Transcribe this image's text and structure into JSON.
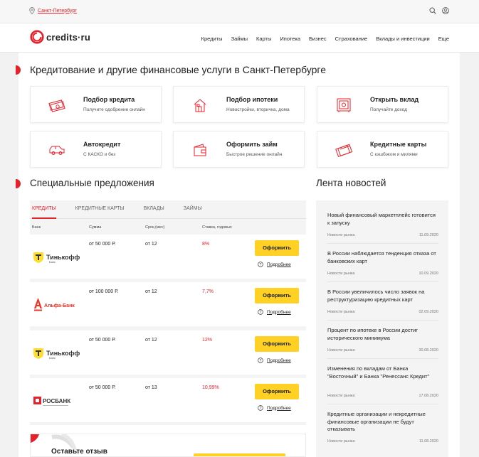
{
  "topbar": {
    "city": "Санкт-Петербург"
  },
  "logo": {
    "text": "credits·ru"
  },
  "nav": [
    "Кредиты",
    "Займы",
    "Карты",
    "Ипотека",
    "Бизнес",
    "Страхование",
    "Вклады и инвестиции",
    "Еще"
  ],
  "page_title": "Кредитование и другие финансовые услуги в Санкт-Петербурге",
  "services": [
    {
      "title": "Подбор кредита",
      "subtitle": "Получите одобрение онлайн",
      "icon": "money-icon"
    },
    {
      "title": "Подбор ипотеки",
      "subtitle": "Новостройки, вторичка, дома",
      "icon": "house-icon"
    },
    {
      "title": "Открыть вклад",
      "subtitle": "Получайте доход",
      "icon": "safe-icon"
    },
    {
      "title": "Автокредит",
      "subtitle": "С КАСКО и без",
      "icon": "car-icon"
    },
    {
      "title": "Оформить займ",
      "subtitle": "Быстрое решение онлайн",
      "icon": "wallet-icon"
    },
    {
      "title": "Кредитные карты",
      "subtitle": "С кэшбэком и милями",
      "icon": "card-icon"
    }
  ],
  "offers": {
    "title": "Специальные предложения",
    "tabs": [
      "КРЕДИТЫ",
      "КРЕДИТНЫЕ КАРТЫ",
      "ВКЛАДЫ",
      "ЗАЙМЫ"
    ],
    "columns": [
      "Банк",
      "Сумма",
      "Срок,(мес)",
      "Ставка, годовых"
    ],
    "rows": [
      {
        "bank": "Тинькофф",
        "bank_sub": "Банк",
        "sum": "от 50 000 Р.",
        "term": "от 12",
        "rate": "8%",
        "button": "Оформить",
        "more": "Подробнее"
      },
      {
        "bank": "Альфа-Банк",
        "bank_sub": "",
        "sum": "от 100 000 Р.",
        "term": "от 12",
        "rate": "7,7%",
        "button": "Оформить",
        "more": "Подробнее"
      },
      {
        "bank": "Тинькофф",
        "bank_sub": "Банк",
        "sum": "от 50 000 Р.",
        "term": "от 12",
        "rate": "12%",
        "button": "Оформить",
        "more": "Подробнее"
      },
      {
        "bank": "РОСБАНК",
        "bank_sub": "",
        "sum": "от 50 000 Р.",
        "term": "от 13",
        "rate": "10,99%",
        "button": "Оформить",
        "more": "Подробнее"
      }
    ]
  },
  "news": {
    "title": "Лента новостей",
    "items": [
      {
        "title": "Новый финансовый маркетплейс готовится к запуску",
        "category": "Новости рынка",
        "date": "11.09.2020"
      },
      {
        "title": "В России наблюдается тенденция отказа от банковских карт",
        "category": "Новости рынка",
        "date": "10.09.2020"
      },
      {
        "title": "В России увеличилось число заявок на реструктуризацию кредитных карт",
        "category": "Новости рынка",
        "date": "02.09.2020"
      },
      {
        "title": "Процент по ипотеке в России достиг исторического минимума",
        "category": "Новости рынка",
        "date": "30.08.2020"
      },
      {
        "title": "Изменения по вкладам от Банка \"Восточный\" и Банка \"Ренессанс Кредит\"",
        "category": "Новости рынка",
        "date": "17.08.2020"
      },
      {
        "title": "Кредитные организации и некредитные финансовые организации не будут отказывать",
        "category": "Новости рынка",
        "date": "11.08.2020"
      }
    ]
  },
  "review": {
    "title": "Оставьте отзыв"
  },
  "colors": {
    "accent": "#e8202a",
    "button": "#ffd124"
  }
}
